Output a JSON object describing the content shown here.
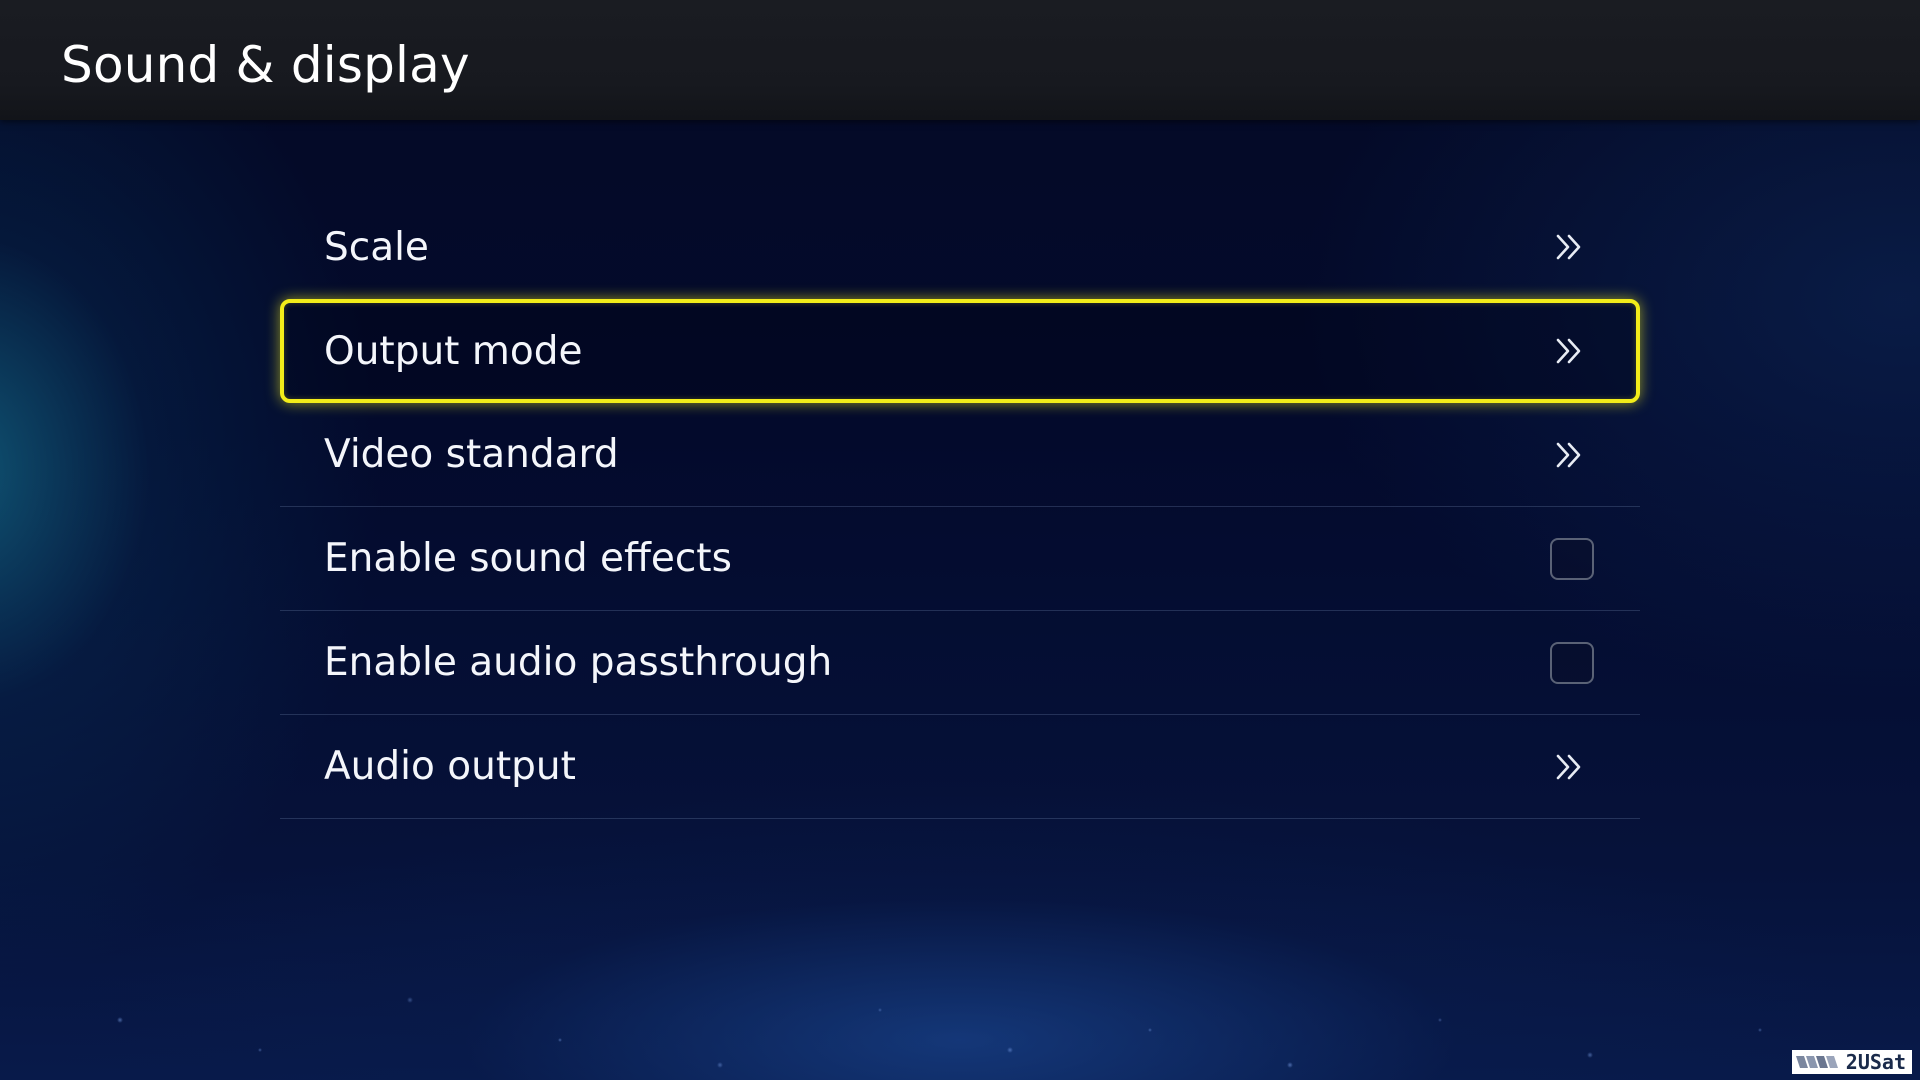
{
  "header": {
    "title": "Sound & display"
  },
  "menu": {
    "items": [
      {
        "label": "Scale",
        "control": "chevron",
        "focused": false
      },
      {
        "label": "Output mode",
        "control": "chevron",
        "focused": true
      },
      {
        "label": "Video standard",
        "control": "chevron",
        "focused": false
      },
      {
        "label": "Enable sound effects",
        "control": "checkbox",
        "checked": false
      },
      {
        "label": "Enable audio passthrough",
        "control": "checkbox",
        "checked": false
      },
      {
        "label": "Audio output",
        "control": "chevron",
        "focused": false
      }
    ]
  },
  "watermark": {
    "text": "2USat"
  },
  "colors": {
    "focus_border": "#f2ec1a",
    "header_bg": "#17191f",
    "background": "#030a2c"
  },
  "icons": {
    "chevron": "double-chevron-right-icon",
    "checkbox": "checkbox-unchecked"
  }
}
